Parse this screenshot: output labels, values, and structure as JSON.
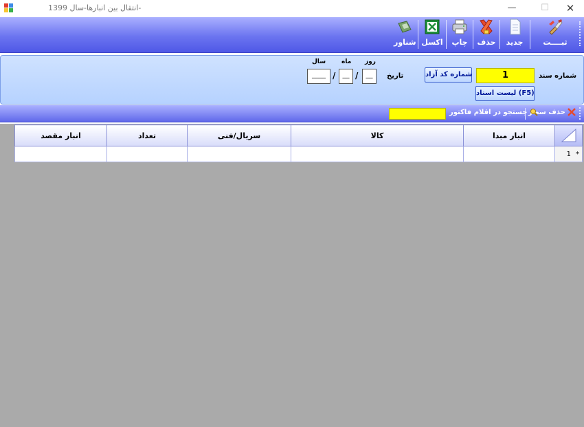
{
  "window": {
    "title": "انتقال بین انبارها-سال 1399-",
    "minimize": "—",
    "maximize": "☐",
    "close": "✕"
  },
  "toolbar": {
    "save_label": "ثبــــت",
    "new_label": "جدید",
    "delete_label": "حذف",
    "print_label": "چاپ",
    "excel_label": "اکسل",
    "float_label": "شناور"
  },
  "header": {
    "doc_number_label": "شماره سند",
    "doc_number_value": "1",
    "free_code_button": "شماره کد آزاد",
    "doc_list_button": "لیست اسناد (F5)",
    "date_label": "تاریخ",
    "day_label": "روز",
    "month_label": "ماه",
    "year_label": "سال",
    "day_value": "__",
    "month_value": "__",
    "year_value": "____"
  },
  "rowbar": {
    "delete_row_label": "حذف سطر",
    "search_label": "جستجو در اقلام فاکتور",
    "search_value": ""
  },
  "grid": {
    "columns": {
      "source_warehouse": "انبار مبدا",
      "item": "کالا",
      "serial": "سریال/فنی",
      "quantity": "تعداد",
      "dest_warehouse": "انبار مقصد"
    },
    "rows": [
      {
        "row_number": "1",
        "marker": "*"
      }
    ]
  },
  "colors": {
    "toolbar_top": "#aab0ff",
    "toolbar_bottom": "#4f58e6",
    "panel_bg": "#c4dbff",
    "highlight_yellow": "#ffff00",
    "grid_bg": "#aaaaaa"
  }
}
